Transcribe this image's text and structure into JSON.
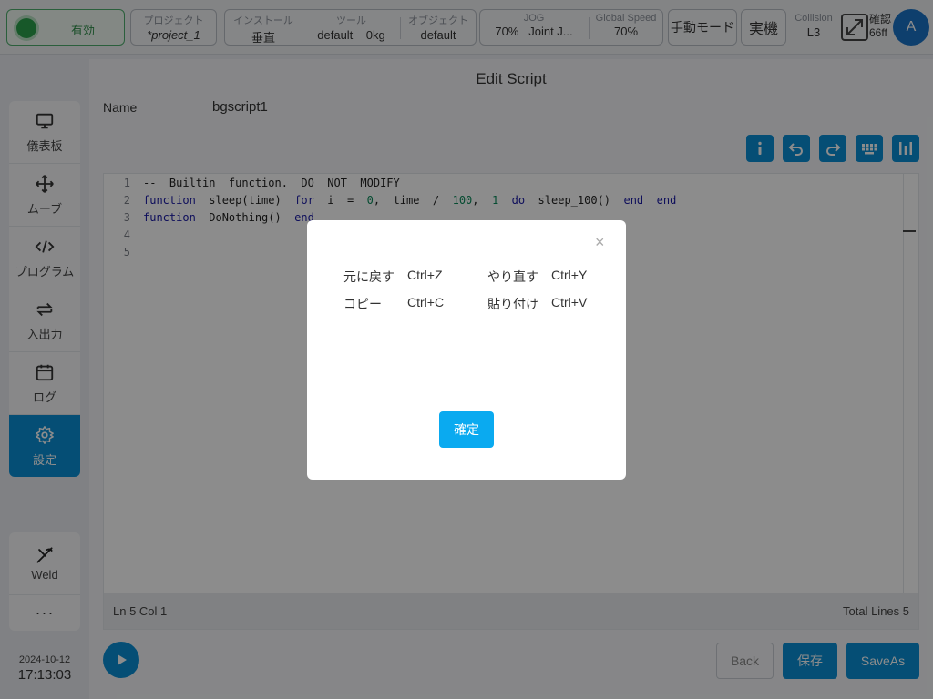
{
  "topbar": {
    "status": "有効",
    "project_label": "プロジェクト",
    "project_value": "*project_1",
    "install_label": "インストール",
    "install_value": "垂直",
    "tool_label": "ツール",
    "tool_value": "default",
    "tool_weight": "0kg",
    "object_label": "オブジェクト",
    "object_value": "default",
    "jog_label": "JOG",
    "jog_speed": "70%",
    "jog_mode": "Joint J...",
    "global_speed_label": "Global Speed",
    "global_speed_value": "70%",
    "manual_mode": "手動モード",
    "real_machine": "実機",
    "collision_label": "Collision",
    "collision_value": "L3",
    "confirm_label": "確認",
    "confirm_value": "66ff",
    "avatar": "A"
  },
  "sidebar": {
    "items": [
      {
        "label": "儀表板",
        "icon": "monitor-icon"
      },
      {
        "label": "ムーブ",
        "icon": "move-icon"
      },
      {
        "label": "プログラム",
        "icon": "code-icon"
      },
      {
        "label": "入出力",
        "icon": "swap-icon"
      },
      {
        "label": "ログ",
        "icon": "calendar-icon"
      },
      {
        "label": "設定",
        "icon": "gear-icon"
      }
    ],
    "weld_label": "Weld",
    "more_label": "···"
  },
  "datetime": {
    "date": "2024-10-12",
    "time": "17:13:03"
  },
  "editor": {
    "title": "Edit Script",
    "name_label": "Name",
    "name_value": "bgscript1",
    "line_numbers": [
      "1",
      "2",
      "3",
      "4",
      "5"
    ],
    "line1": "--  Builtin  function.  DO  NOT  MODIFY",
    "line2": {
      "k1": "function",
      "t1": "  sleep(time)  ",
      "k2": "for",
      "t2": "  i  =  ",
      "n1": "0",
      "t3": ",  time  /  ",
      "n2": "100",
      "t4": ",  ",
      "n3": "1",
      "t5": "  ",
      "k3": "do",
      "t6": "  sleep_100()  ",
      "k4": "end",
      "t7": "  ",
      "k5": "end"
    },
    "line3": {
      "k1": "function",
      "t1": "  DoNothing()  ",
      "k2": "end"
    },
    "cursor": "Ln 5 Col 1",
    "total_lines": "Total Lines 5"
  },
  "buttons": {
    "back": "Back",
    "save": "保存",
    "saveas": "SaveAs"
  },
  "modal": {
    "close": "×",
    "undo_label": "元に戻す",
    "undo_key": "Ctrl+Z",
    "redo_label": "やり直す",
    "redo_key": "Ctrl+Y",
    "copy_label": "コピー",
    "copy_key": "Ctrl+C",
    "paste_label": "貼り付け",
    "paste_key": "Ctrl+V",
    "ok": "確定"
  },
  "colors": {
    "accent": "#0a8fd6",
    "status_green": "#2ba14b",
    "ok_button": "#0aaaf0"
  }
}
